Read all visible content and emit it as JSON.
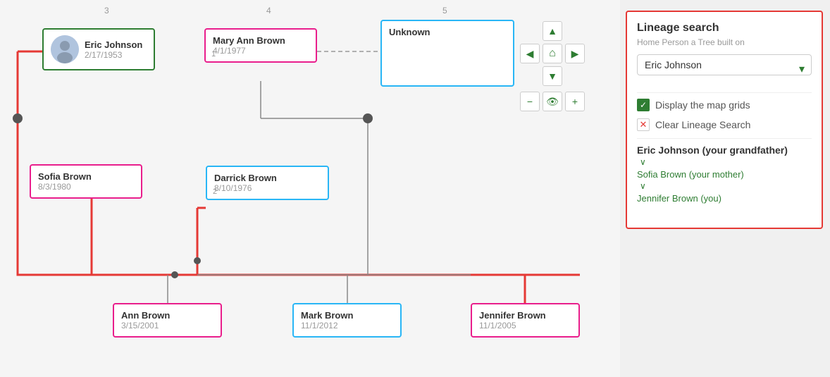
{
  "tree": {
    "column_numbers": [
      "3",
      "4",
      "5"
    ],
    "nav": {
      "up": "▲",
      "left": "◀",
      "home": "⌂",
      "right": "▶",
      "down": "▼",
      "zoom_minus": "−",
      "eye": "👁",
      "zoom_plus": "+"
    },
    "persons": [
      {
        "id": "eric",
        "name": "Eric Johnson",
        "date": "2/17/1953",
        "border": "#2e7d32",
        "has_avatar": true
      },
      {
        "id": "mary",
        "name": "Mary Ann Brown",
        "date": "4/1/1977",
        "border": "#e91e8c",
        "number": "1"
      },
      {
        "id": "unknown",
        "name": "Unknown",
        "date": "",
        "border": "#29b6f6"
      },
      {
        "id": "sofia",
        "name": "Sofia Brown",
        "date": "8/3/1980",
        "border": "#e91e8c"
      },
      {
        "id": "darrick",
        "name": "Darrick Brown",
        "date": "8/10/1976",
        "border": "#29b6f6",
        "number": "2"
      },
      {
        "id": "ann",
        "name": "Ann Brown",
        "date": "3/15/2001",
        "border": "#e91e8c"
      },
      {
        "id": "mark",
        "name": "Mark Brown",
        "date": "11/1/2012",
        "border": "#29b6f6"
      },
      {
        "id": "jennifer",
        "name": "Jennifer Brown",
        "date": "11/1/2005",
        "border": "#e91e8c"
      }
    ]
  },
  "sidebar": {
    "title": "Lineage search",
    "subtitle": "Home Person a Tree built on",
    "selected_person": "Eric Johnson",
    "display_grids_label": "Display the map grids",
    "clear_lineage_label": "Clear Lineage Search",
    "lineage_heading": "Eric Johnson (your grandfather)",
    "lineage_link1": "Sofia Brown (your mother)",
    "lineage_link2": "Jennifer Brown (you)",
    "chevron": "∨"
  }
}
